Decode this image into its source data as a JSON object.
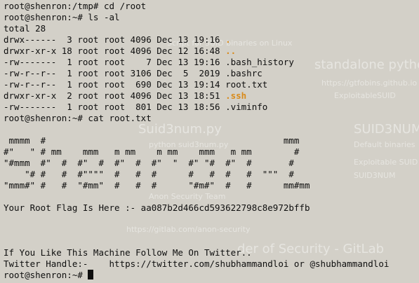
{
  "commands": {
    "line1": "root@shenron:/tmp# cd /root",
    "line2": "root@shenron:~# ls -al",
    "line3": "root@shenron:~# cat root.txt",
    "prompt": "root@shenron:~# "
  },
  "listing": {
    "total": "total 28",
    "entries": [
      {
        "prefix": "drwx------  3 root root 4096 Dec 13 19:16 ",
        "name": ".",
        "colored": true
      },
      {
        "prefix": "drwxr-xr-x 18 root root 4096 Dec 12 16:48 ",
        "name": "..",
        "colored": true
      },
      {
        "prefix": "-rw-------  1 root root    7 Dec 13 19:16 ",
        "name": ".bash_history",
        "colored": false
      },
      {
        "prefix": "-rw-r--r--  1 root root 3106 Dec  5  2019 ",
        "name": ".bashrc",
        "colored": false
      },
      {
        "prefix": "-rw-r--r--  1 root root  690 Dec 13 19:14 ",
        "name": "root.txt",
        "colored": false
      },
      {
        "prefix": "drwxr-xr-x  2 root root 4096 Dec 13 18:51 ",
        "name": ".ssh",
        "colored": true
      },
      {
        "prefix": "-rw-------  1 root root  801 Dec 13 18:56 ",
        "name": ".viminfo",
        "colored": false
      }
    ]
  },
  "ascii_art": [
    " mmmm  #                                             mmm",
    "#\"   \" # mm    mmm   m mm    m mm    mmm   m mm        #",
    "\"#mmm  #\"  #  #\"  #  #\"  #  #\"  \"  #\" \"#  #\"  #       #",
    "    \"# #   #  #\"\"\"\"  #   #  #      #   #  #   #  \"\"\"  #",
    "\"mmm#\" #   #  \"#mm\"  #   #  #      \"#m#\"  #   #      mm#mm"
  ],
  "flag_line": "Your Root Flag Is Here :- aa087b2d466cd593622798c8e972bffb",
  "follow_line": "If You Like This Machine Follow Me On Twitter..",
  "twitter_line": "Twitter Handle:-    https://twitter.com/shubhammandloi or @shubhammandloi",
  "colors": {
    "background": "#d3d0c8",
    "text": "#0e0e0e",
    "directory": "#d98a1a"
  },
  "background_ghost": {
    "g1": "Script for SUID binaries on Linux",
    "g2": "standalone pytho",
    "g3": "https://gtfobins.github.io",
    "g4": "ExploitableSUID",
    "g5": "Suid3num.py",
    "g6": "SUID3NUM",
    "g7": "python suid3num.py",
    "g8": "Default binaries",
    "g9": "Exploitable SUID",
    "g10": "SUID3NUM",
    "g11": "Anon Security Team",
    "g12": "https://gitlab.com/anon-security",
    "g13": "der of Security - GitLab"
  }
}
